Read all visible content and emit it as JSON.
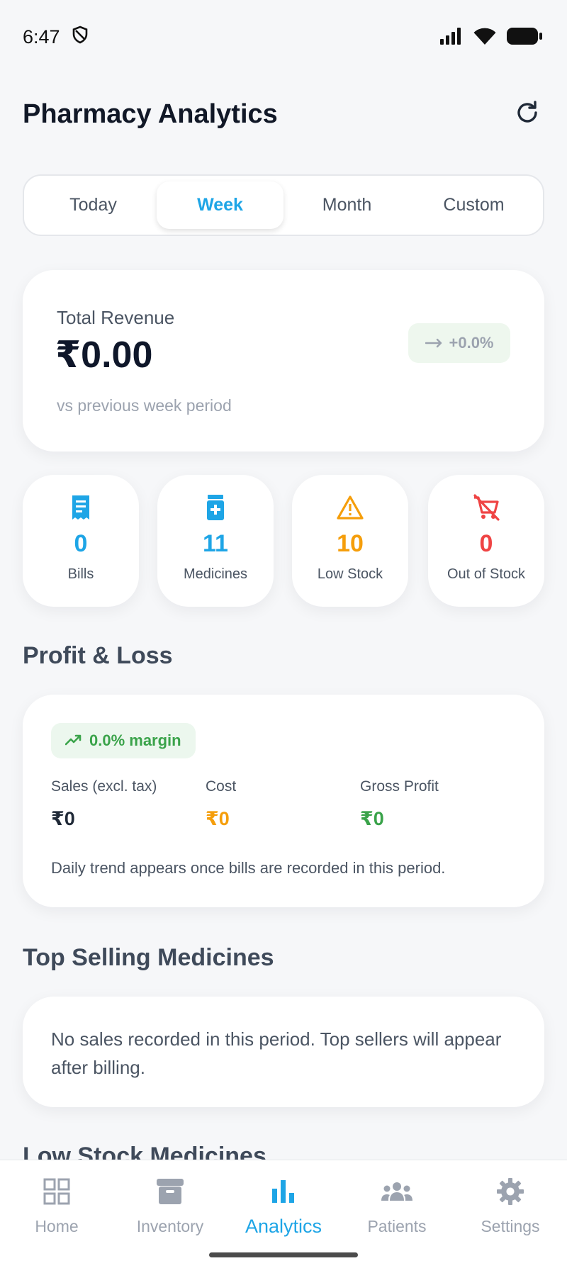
{
  "status_bar": {
    "time": "6:47"
  },
  "header": {
    "title": "Pharmacy Analytics"
  },
  "period_tabs": [
    {
      "label": "Today"
    },
    {
      "label": "Week"
    },
    {
      "label": "Month"
    },
    {
      "label": "Custom"
    }
  ],
  "selected_period": "Week",
  "revenue": {
    "label": "Total Revenue",
    "value": "₹0.00",
    "comparison": "vs previous week period",
    "change": "+0.0%"
  },
  "stats": [
    {
      "value": "0",
      "label": "Bills",
      "color": "#1ea5e6",
      "icon": "receipt-icon"
    },
    {
      "value": "11",
      "label": "Medicines",
      "color": "#1ea5e6",
      "icon": "medicine-bottle-icon"
    },
    {
      "value": "10",
      "label": "Low Stock",
      "color": "#f59e0b",
      "icon": "warning-icon"
    },
    {
      "value": "0",
      "label": "Out of Stock",
      "color": "#ef4444",
      "icon": "cart-off-icon"
    }
  ],
  "profit_loss": {
    "title": "Profit & Loss",
    "margin": "0.0% margin",
    "sales_label": "Sales (excl. tax)",
    "sales_value": "₹0",
    "cost_label": "Cost",
    "cost_value": "₹0",
    "profit_label": "Gross Profit",
    "profit_value": "₹0",
    "note": "Daily trend appears once bills are recorded in this period."
  },
  "top_selling": {
    "title": "Top Selling Medicines",
    "empty_message": "No sales recorded in this period. Top sellers will appear after billing."
  },
  "low_stock": {
    "title": "Low Stock Medicines"
  },
  "nav": [
    {
      "label": "Home",
      "icon": "grid-icon"
    },
    {
      "label": "Inventory",
      "icon": "archive-icon"
    },
    {
      "label": "Analytics",
      "icon": "bar-chart-icon"
    },
    {
      "label": "Patients",
      "icon": "people-icon"
    },
    {
      "label": "Settings",
      "icon": "gear-icon"
    }
  ],
  "active_nav": "Analytics",
  "colors": {
    "accent": "#1ea5e6",
    "warning": "#f59e0b",
    "danger": "#ef4444",
    "success": "#3aa34a"
  }
}
